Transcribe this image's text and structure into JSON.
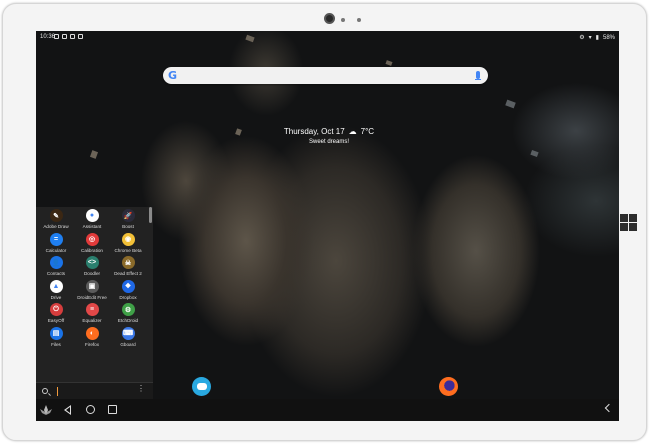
{
  "status_bar": {
    "time": "10:36",
    "battery": "58%"
  },
  "search": {
    "logo": "G"
  },
  "widget": {
    "date": "Thursday, Oct 17",
    "weather_icon": "cloud-icon",
    "temperature": "7°C",
    "greeting": "Sweet dreams!"
  },
  "drawer": {
    "apps": [
      {
        "label": "Adobe Draw",
        "color": "#3b2713",
        "glyph": "✎"
      },
      {
        "label": "Assistant",
        "color": "#ffffff",
        "glyph": "●"
      },
      {
        "label": "Boost",
        "color": "#2b2b3a",
        "glyph": "🚀"
      },
      {
        "label": "Calculator",
        "color": "#1f7ff1",
        "glyph": "="
      },
      {
        "label": "Calibration",
        "color": "#e23a3a",
        "glyph": "◎"
      },
      {
        "label": "Chrome Beta",
        "color": "#f2c037",
        "glyph": "◉"
      },
      {
        "label": "Contacts",
        "color": "#1a73e8",
        "glyph": "👤"
      },
      {
        "label": "Doodler",
        "color": "#2a7f6e",
        "glyph": "<>"
      },
      {
        "label": "Dead Effect 2",
        "color": "#8a6a2a",
        "glyph": "☠"
      },
      {
        "label": "Drive",
        "color": "#ffffff",
        "glyph": "▲"
      },
      {
        "label": "DroidEdit Free",
        "color": "#5b5b5b",
        "glyph": "▣"
      },
      {
        "label": "Dropbox",
        "color": "#1f68e6",
        "glyph": "❖"
      },
      {
        "label": "EasyOff",
        "color": "#d63d3d",
        "glyph": "⏻"
      },
      {
        "label": "Equalizer",
        "color": "#e24848",
        "glyph": "≡"
      },
      {
        "label": "EtchDroid",
        "color": "#3fa047",
        "glyph": "⚙"
      },
      {
        "label": "Files",
        "color": "#1a73e8",
        "glyph": "▤"
      },
      {
        "label": "Firefox",
        "color": "#ff6d1f",
        "glyph": "◐"
      },
      {
        "label": "Gboard",
        "color": "#3b78e7",
        "glyph": "⌨"
      }
    ]
  },
  "dock": {
    "chat_icon": "chat-icon",
    "firefox_icon": "firefox-icon"
  },
  "navbar": {
    "back": "back-icon",
    "home": "home-icon",
    "recents": "recents-icon"
  }
}
